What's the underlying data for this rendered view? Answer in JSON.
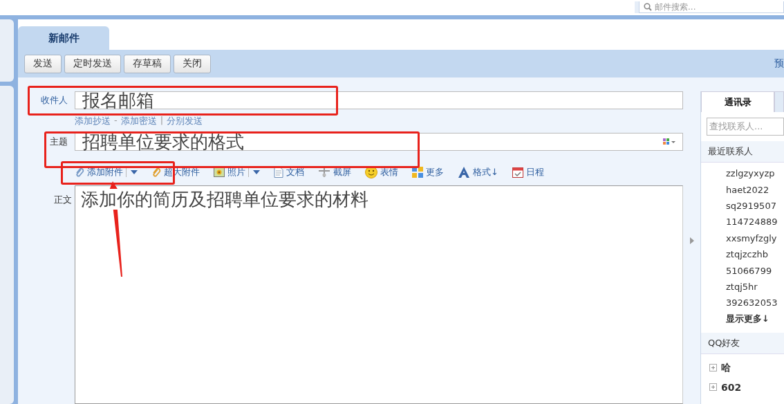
{
  "header": {
    "search": {
      "placeholder": "邮件搜索..."
    }
  },
  "tabs": [
    {
      "label": "新邮件",
      "selected": true
    }
  ],
  "toolbar": {
    "buttons": [
      "发送",
      "定时发送",
      "存草稿",
      "关闭"
    ],
    "right_link": "预"
  },
  "form": {
    "recipient": {
      "label": "收件人",
      "value": "报名邮箱"
    },
    "links": [
      {
        "kind": "link",
        "text": "添加抄送"
      },
      {
        "kind": "sep",
        "text": "-"
      },
      {
        "kind": "link",
        "text": "添加密送"
      },
      {
        "kind": "sep",
        "text": "|"
      },
      {
        "kind": "link",
        "text": "分别发送"
      }
    ],
    "subject": {
      "label": "主题",
      "value": "招聘单位要求的格式"
    },
    "tools": [
      {
        "kind": "attach",
        "label": "添加附件",
        "dropdown": true
      },
      {
        "kind": "bigattach",
        "label": "超大附件",
        "dropdown": false
      },
      {
        "kind": "photo",
        "label": "照片",
        "dropdown": true
      },
      {
        "kind": "doc",
        "label": "文档",
        "dropdown": false
      },
      {
        "kind": "screenshot",
        "label": "截屏",
        "dropdown": false
      },
      {
        "kind": "emoji",
        "label": "表情",
        "dropdown": false
      },
      {
        "kind": "more",
        "label": "更多",
        "dropdown": false
      },
      {
        "kind": "format",
        "label": "格式↓",
        "dropdown": false
      },
      {
        "kind": "calendar",
        "label": "日程",
        "dropdown": false
      }
    ],
    "body": {
      "label": "正文",
      "value": "添加你的简历及招聘单位要求的材料"
    }
  },
  "contacts": {
    "tabs": [
      {
        "label": "通讯录",
        "selected": true
      }
    ],
    "search": {
      "placeholder": "查找联系人..."
    },
    "recent": {
      "title": "最近联系人",
      "items": [
        "zzlgzyxyzp",
        "haet2022",
        "sq2919507",
        "114724889",
        "xxsmyfzgly",
        "ztqjzczhb",
        "51066799",
        "ztqj5hr",
        "392632053"
      ],
      "more": "显示更多↓"
    },
    "qq": {
      "title": "QQ好友",
      "groups": [
        {
          "name": "哈",
          "expanded": false
        },
        {
          "name": "602",
          "expanded": false
        }
      ]
    }
  }
}
